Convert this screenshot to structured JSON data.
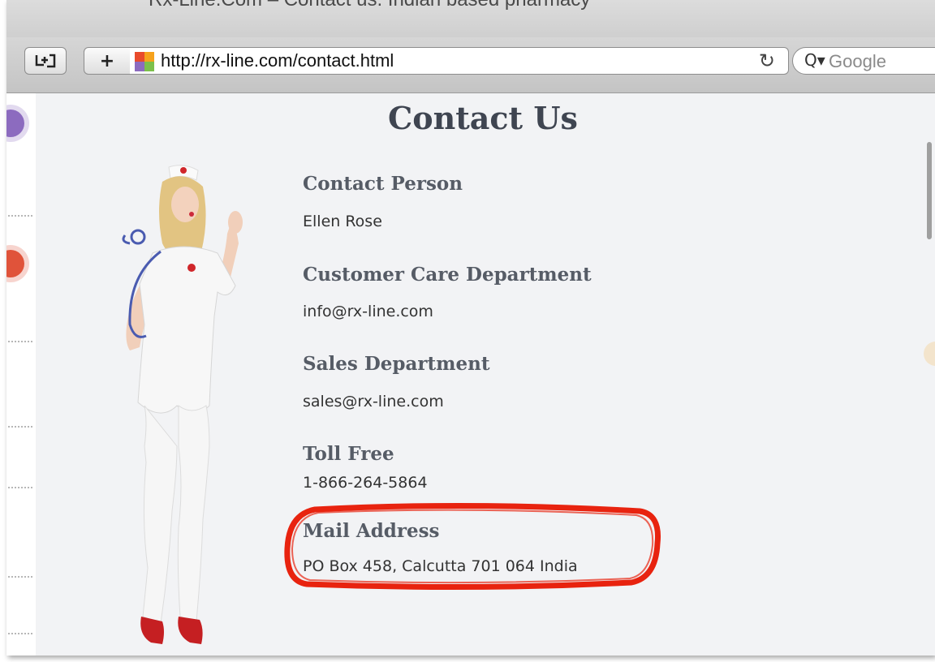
{
  "window": {
    "title": "Rx-Line.Com – Contact us. Indian based pharmacy"
  },
  "toolbar": {
    "bookmarks_icon": "bookmarks-icon",
    "add_label": "+",
    "url": "http://rx-line.com/contact.html",
    "reload_icon": "reload-icon",
    "search_placeholder": "Google"
  },
  "page": {
    "title": "Contact Us",
    "sections": [
      {
        "heading": "Contact Person",
        "value": "Ellen Rose"
      },
      {
        "heading": "Customer Care Department",
        "value": "info@rx-line.com"
      },
      {
        "heading": "Sales Department",
        "value": "sales@rx-line.com"
      },
      {
        "heading": "Toll Free",
        "value": "1-866-264-5864"
      },
      {
        "heading": "Mail Address",
        "value": "PO Box 458, Calcutta 701 064 India"
      }
    ]
  },
  "colors": {
    "highlight": "#e8230f",
    "heading": "#565c66"
  }
}
